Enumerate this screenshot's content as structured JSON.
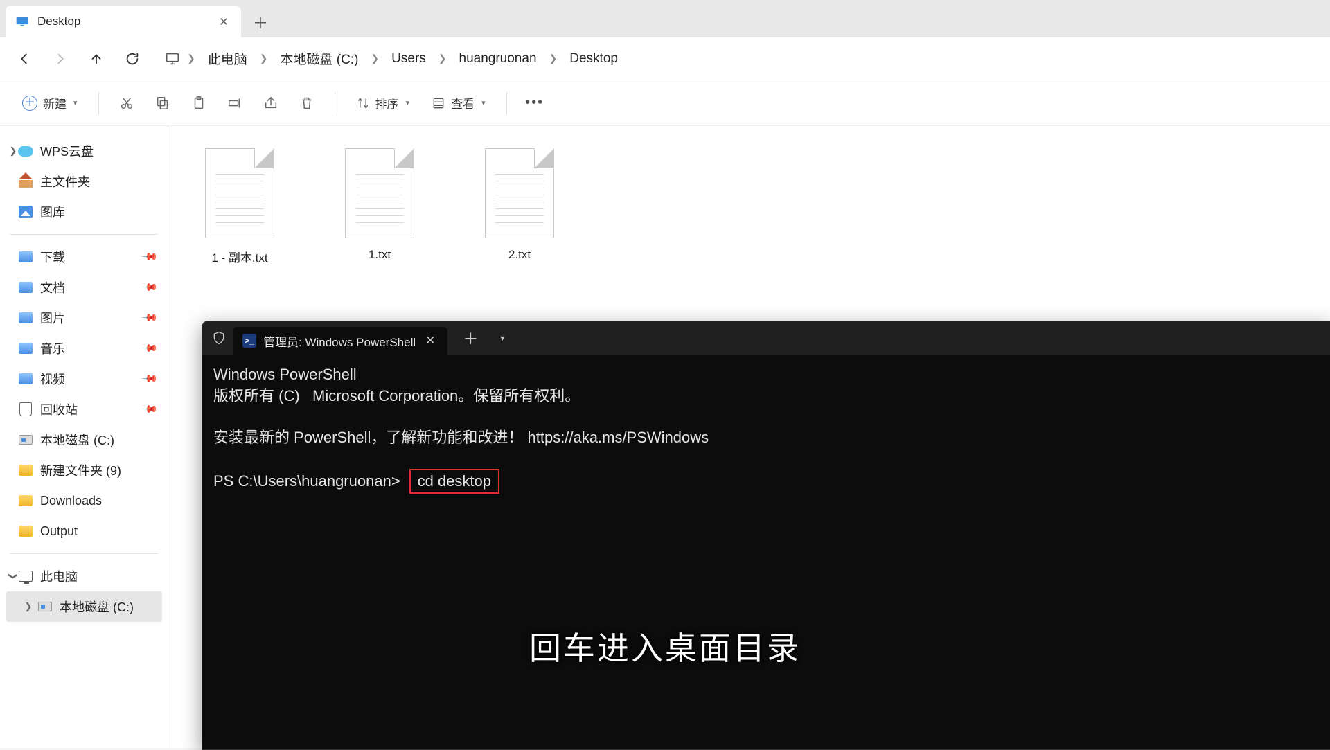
{
  "tab": {
    "title": "Desktop"
  },
  "breadcrumb": [
    "此电脑",
    "本地磁盘 (C:)",
    "Users",
    "huangruonan",
    "Desktop"
  ],
  "toolbar": {
    "new_label": "新建",
    "sort_label": "排序",
    "view_label": "查看"
  },
  "sidebar": {
    "wps": "WPS云盘",
    "home": "主文件夹",
    "gallery": "图库",
    "quick": [
      {
        "label": "下载"
      },
      {
        "label": "文档"
      },
      {
        "label": "图片"
      },
      {
        "label": "音乐"
      },
      {
        "label": "视频"
      },
      {
        "label": "回收站"
      },
      {
        "label": "本地磁盘 (C:)"
      },
      {
        "label": "新建文件夹 (9)"
      },
      {
        "label": "Downloads"
      },
      {
        "label": "Output"
      }
    ],
    "this_pc": "此电脑",
    "drive_c": "本地磁盘 (C:)"
  },
  "files": [
    {
      "name": "1 - 副本.txt"
    },
    {
      "name": "1.txt"
    },
    {
      "name": "2.txt"
    }
  ],
  "terminal": {
    "tab_title": "管理员: Windows PowerShell",
    "line1": "Windows PowerShell",
    "line2": "版权所有 (C)   Microsoft Corporation。保留所有权利。",
    "line3": "安装最新的 PowerShell，了解新功能和改进！ https://aka.ms/PSWindows",
    "prompt": "PS C:\\Users\\huangruonan>",
    "command": "cd desktop"
  },
  "caption": "回车进入桌面目录"
}
